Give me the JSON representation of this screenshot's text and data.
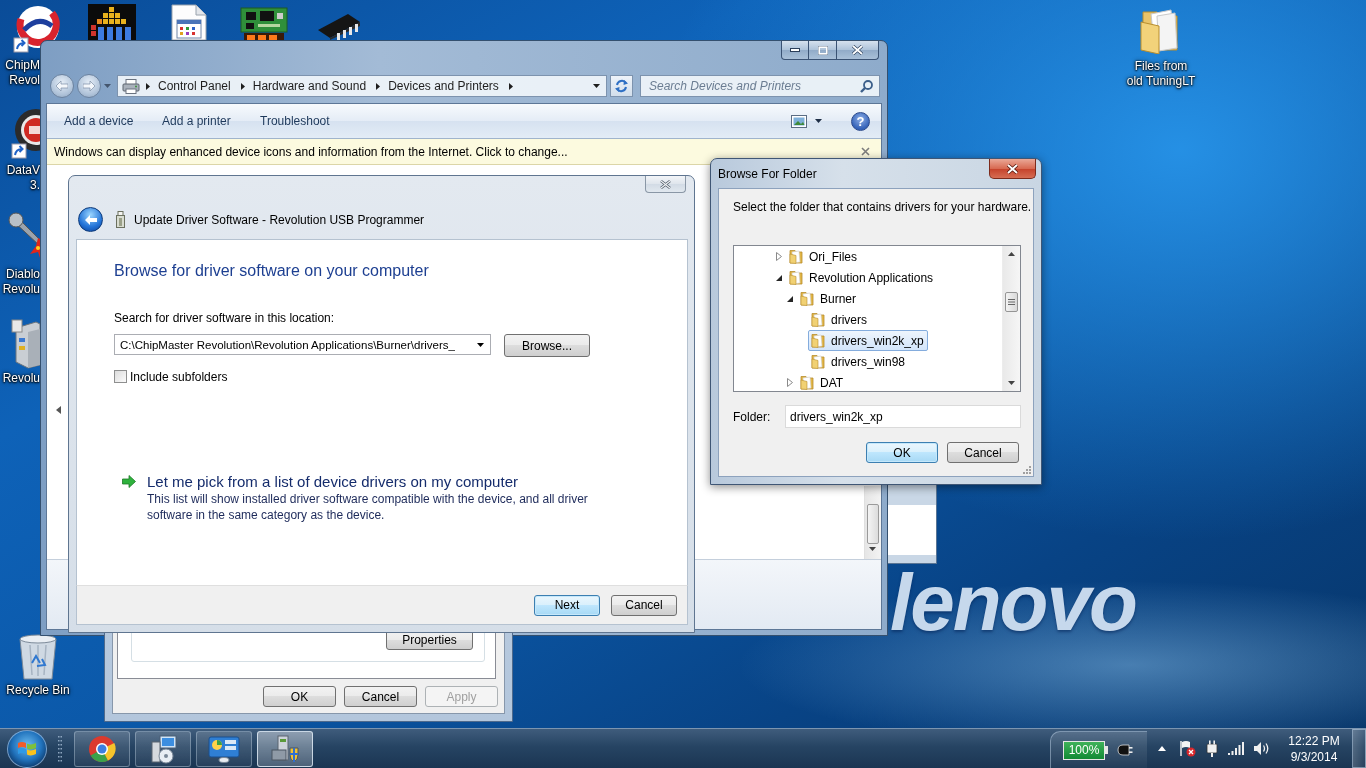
{
  "desktop": {
    "wallpaper_logo": "lenovo",
    "icons": [
      {
        "label_lines": [
          "ChipM",
          "Revol"
        ]
      },
      {
        "label_lines": [
          "DataV",
          "3."
        ]
      },
      {
        "label_lines": [
          "Diablo",
          "Revolu"
        ]
      },
      {
        "label_lines": [
          "Revolu"
        ]
      },
      {
        "label_lines": [
          "Recycle Bin"
        ]
      },
      {
        "label_lines": [
          "Files from",
          "old TuningLT"
        ]
      }
    ]
  },
  "explorer": {
    "breadcrumb": [
      "Control Panel",
      "Hardware and Sound",
      "Devices and Printers"
    ],
    "search": {
      "placeholder": "Search Devices and Printers"
    },
    "commands": [
      "Add a device",
      "Add a printer",
      "Troubleshoot"
    ],
    "help_button": "?",
    "info_bar": "Windows can display enhanced device icons and information from the Internet. Click to change..."
  },
  "properties_dialog": {
    "properties_button": "Properties",
    "buttons": [
      {
        "label": "OK",
        "disabled": false
      },
      {
        "label": "Cancel",
        "disabled": false
      },
      {
        "label": "Apply",
        "disabled": true
      }
    ]
  },
  "update_driver": {
    "title": "Update Driver Software - Revolution USB Programmer",
    "heading": "Browse for driver software on your computer",
    "location_label": "Search for driver software in this location:",
    "location": "C:\\ChipMaster Revolution\\Revolution Applications\\Burner\\drivers_",
    "browse_button": "Browse...",
    "include_subfolders": {
      "label": "Include subfolders",
      "checked": false
    },
    "pick_link": {
      "title": "Let me pick from a list of device drivers on my computer",
      "description": "This list will show installed driver software compatible with the device, and all driver software in the same category as the device."
    },
    "buttons": [
      {
        "label": "Next",
        "default": true
      },
      {
        "label": "Cancel",
        "default": false
      }
    ]
  },
  "browse_for_folder": {
    "title": "Browse For Folder",
    "instruction": "Select the folder that contains drivers for your hardware.",
    "tree": [
      {
        "name": "Ori_Files",
        "expanded": false,
        "selected": false
      },
      {
        "name": "Revolution Applications",
        "expanded": true,
        "selected": false,
        "children": [
          {
            "name": "Burner",
            "expanded": true,
            "selected": false,
            "children": [
              {
                "name": "drivers",
                "selected": false
              },
              {
                "name": "drivers_win2k_xp",
                "selected": true
              },
              {
                "name": "drivers_win98",
                "selected": false
              }
            ]
          },
          {
            "name": "DAT",
            "expanded": false,
            "selected": false
          }
        ]
      }
    ],
    "folder_label": "Folder:",
    "folder": "drivers_win2k_xp",
    "buttons": [
      {
        "label": "OK",
        "default": true
      },
      {
        "label": "Cancel",
        "default": false
      }
    ]
  },
  "taskbar": {
    "buttons": [
      {
        "active": false
      },
      {
        "active": false
      },
      {
        "active": false
      },
      {
        "active": true
      }
    ],
    "battery": "100%",
    "time": "12:22 PM",
    "date": "9/3/2014"
  }
}
